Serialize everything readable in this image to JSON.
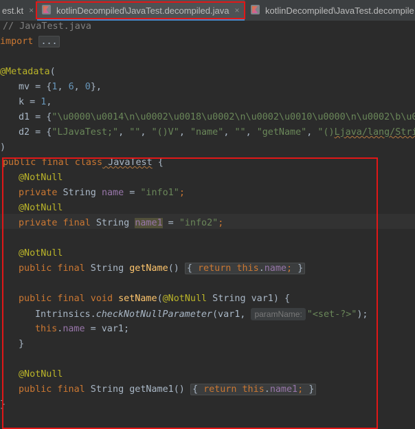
{
  "tabs": [
    {
      "label": "est.kt",
      "active": false
    },
    {
      "label": "kotlinDecompiled\\JavaTest.decompiled.java",
      "active": true
    },
    {
      "label": "kotlinDecompiled\\JavaTest.decompile",
      "active": false
    }
  ],
  "icons": {
    "close": "×",
    "close_icon_name": "close-icon",
    "file_icon_name": "kotlin-file-icon"
  },
  "colors": {
    "highlight_box": "#e21717",
    "background": "#2b2b2b",
    "keyword": "#cc7832",
    "annotation": "#bbb529",
    "string": "#6a8759",
    "number": "#6897bb",
    "field": "#9876aa",
    "method": "#ffc66d"
  },
  "code": {
    "l1": {
      "cmt": "// JavaTest.java"
    },
    "l2": {
      "kw": "import",
      "fold": "..."
    },
    "l4": {
      "ann": "@Metadata",
      "paren": "("
    },
    "l5": {
      "a": "mv = {",
      "n1": "1",
      "c1": ", ",
      "n2": "6",
      "c2": ", ",
      "n3": "0",
      "b": "},"
    },
    "l6": {
      "a": "k = ",
      "n": "1",
      "b": ","
    },
    "l7": {
      "a": "d1 = {",
      "s": "\"\\u0000\\u0014\\n\\u0002\\u0018\\u0002\\n\\u0002\\u0010\\u0000\\n\\u0002\\b\\u0"
    },
    "l8": {
      "a": "d2 = {",
      "s1": "\"LJavaTest;\"",
      "c1": ", ",
      "s2": "\"\"",
      "c2": ", ",
      "s3": "\"()V\"",
      "c3": ", ",
      "s4": "\"name\"",
      "c4": ", ",
      "s5": "\"\"",
      "c5": ", ",
      "s6": "\"getName\"",
      "c6": ", ",
      "s7a": "\"()",
      "s7b": "Ljava/lang/Stri"
    },
    "l9": {
      "a": ")"
    },
    "l10": {
      "kw": "public final class",
      "name": " JavaTest",
      "b": " {"
    },
    "l11": {
      "ann": "@NotNull"
    },
    "l12": {
      "kw": "private",
      "t": " String ",
      "f": "name",
      "eq": " = ",
      "s": "\"info1\"",
      "sc": ";"
    },
    "l13": {
      "ann": "@NotNull"
    },
    "l14": {
      "kw": "private final",
      "t": " String ",
      "f": "name1",
      "eq": " = ",
      "s": "\"info2\"",
      "sc": ";"
    },
    "l16": {
      "ann": "@NotNull"
    },
    "l17": {
      "kw": "public final",
      "t": " String ",
      "m": "getName",
      "p": "() ",
      "f1": "{ ",
      "ret": "return",
      "sp": " ",
      "ths": "this",
      "dot": ".",
      "f": "name",
      "sc": ";",
      "f2": " }"
    },
    "l19": {
      "kw": "public final void",
      "sp": " ",
      "m": "setName",
      "p": "(",
      "ann": "@NotNull",
      "t": " String var1) {"
    },
    "l20": {
      "cls": "Intrinsics.",
      "m": "checkNotNullParameter",
      "a": "(var1, ",
      "hint": "paramName:",
      "s": "\"<set-?>\"",
      "e": ");"
    },
    "l21": {
      "ths": "this",
      "dot": ".",
      "f": "name",
      "e": " = var1;"
    },
    "l22": {
      "b": "}"
    },
    "l24": {
      "ann": "@NotNull"
    },
    "l25": {
      "kw": "public final",
      "t": " String ",
      "m": "getName1",
      "p": "() ",
      "f1": "{ ",
      "ret": "return",
      "sp": " ",
      "ths": "this",
      "dot": ".",
      "f": "name1",
      "sc": ";",
      "f2": " }"
    },
    "l26": {
      "b": "}"
    }
  }
}
